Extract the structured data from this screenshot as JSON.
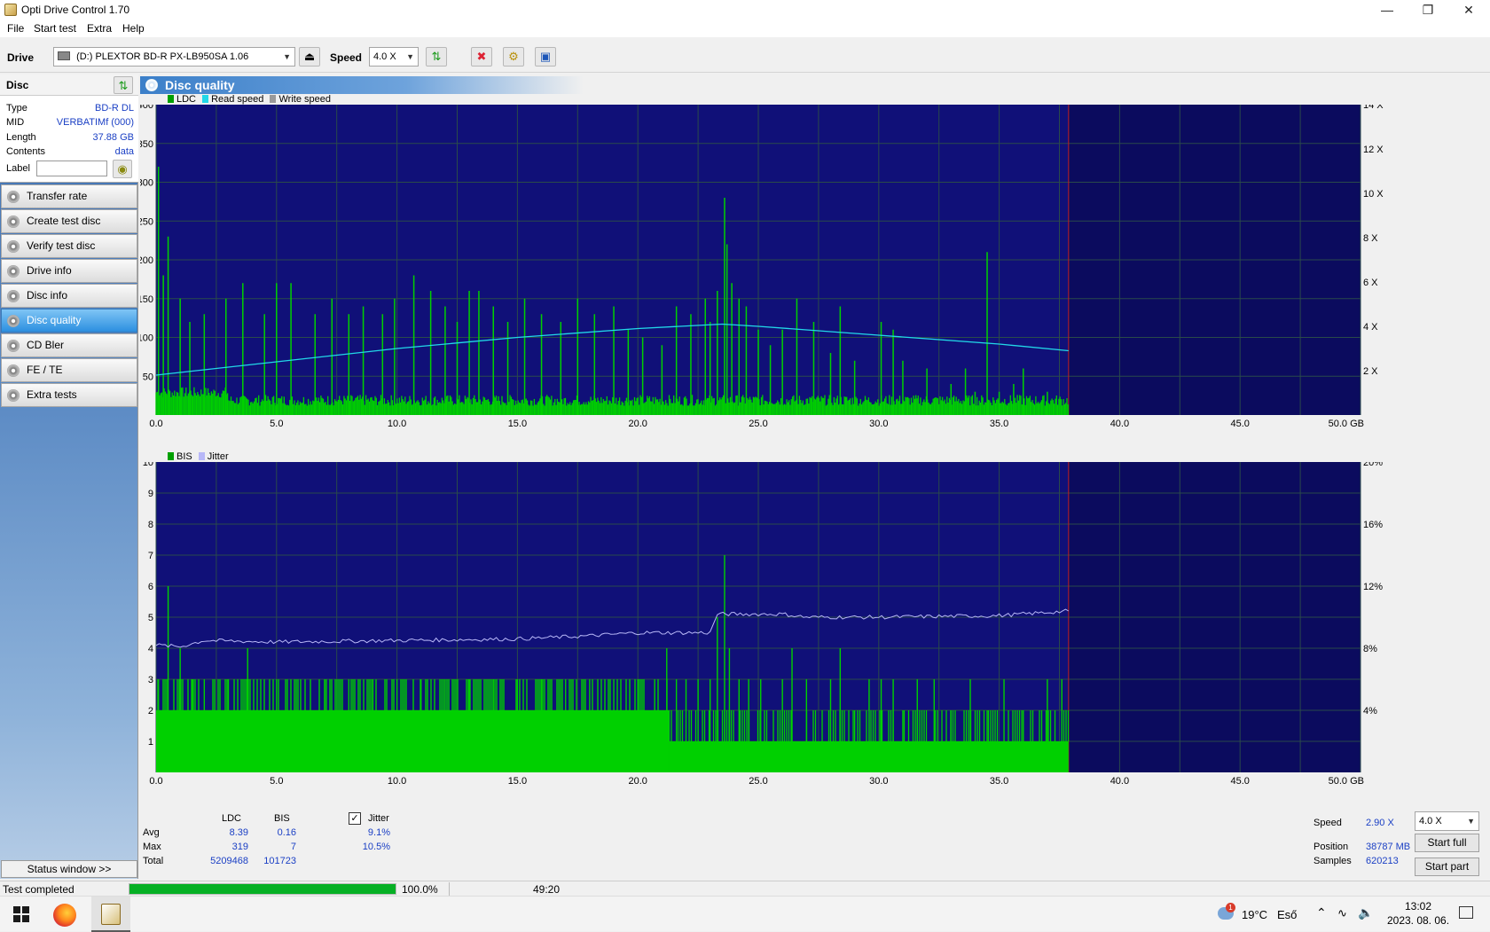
{
  "window": {
    "title": "Opti Drive Control 1.70"
  },
  "menu": {
    "items": [
      "File",
      "Start test",
      "Extra",
      "Help"
    ]
  },
  "toolbar": {
    "drive_label": "Drive",
    "drive_value": "(D:)   PLEXTOR BD-R  PX-LB950SA 1.06",
    "speed_label": "Speed",
    "speed_value": "4.0 X"
  },
  "disc": {
    "header": "Disc",
    "rows": [
      {
        "key": "Type",
        "value": "BD-R DL"
      },
      {
        "key": "MID",
        "value": "VERBATIMf (000)"
      },
      {
        "key": "Length",
        "value": "37.88 GB"
      },
      {
        "key": "Contents",
        "value": "data"
      }
    ],
    "label_key": "Label",
    "label_value": ""
  },
  "nav": {
    "items": [
      {
        "label": "Transfer rate",
        "active": false
      },
      {
        "label": "Create test disc",
        "active": false
      },
      {
        "label": "Verify test disc",
        "active": false
      },
      {
        "label": "Drive info",
        "active": false
      },
      {
        "label": "Disc info",
        "active": false
      },
      {
        "label": "Disc quality",
        "active": true
      },
      {
        "label": "CD Bler",
        "active": false
      },
      {
        "label": "FE / TE",
        "active": false
      },
      {
        "label": "Extra tests",
        "active": false
      }
    ],
    "status_window": "Status window >>"
  },
  "panel": {
    "title": "Disc quality"
  },
  "chart_data": [
    {
      "type": "bar",
      "legend": [
        "LDC",
        "Read speed",
        "Write speed"
      ],
      "colors": {
        "LDC": "#00d000",
        "Read speed": "#22d8e8",
        "Write speed": "#9a9a9a",
        "background": "#0b0b5e"
      },
      "x_label_unit": "GB",
      "xlim": [
        0,
        50
      ],
      "x_ticks": [
        "0.0",
        "5.0",
        "10.0",
        "15.0",
        "20.0",
        "25.0",
        "30.0",
        "35.0",
        "40.0",
        "45.0",
        "50.0 GB"
      ],
      "ylim": [
        0,
        400
      ],
      "y_ticks": [
        "50",
        "100",
        "150",
        "200",
        "250",
        "300",
        "350",
        "400"
      ],
      "y2lim": [
        0,
        14
      ],
      "y2_ticks": [
        "2 X",
        "4 X",
        "6 X",
        "8 X",
        "10 X",
        "12 X",
        "14 X"
      ],
      "test_end_gb": 37.88,
      "ldc_base": 12,
      "ldc_spikes": [
        [
          0.1,
          320
        ],
        [
          0.3,
          180
        ],
        [
          0.5,
          230
        ],
        [
          1.0,
          150
        ],
        [
          1.4,
          120
        ],
        [
          2.0,
          130
        ],
        [
          2.9,
          150
        ],
        [
          3.6,
          170
        ],
        [
          4.5,
          130
        ],
        [
          5.0,
          170
        ],
        [
          5.6,
          170
        ],
        [
          6.6,
          130
        ],
        [
          7.3,
          150
        ],
        [
          8.0,
          130
        ],
        [
          8.6,
          140
        ],
        [
          9.4,
          130
        ],
        [
          9.9,
          150
        ],
        [
          10.7,
          180
        ],
        [
          11.4,
          160
        ],
        [
          12.0,
          140
        ],
        [
          12.5,
          120
        ],
        [
          13.0,
          160
        ],
        [
          13.4,
          160
        ],
        [
          14.0,
          140
        ],
        [
          14.6,
          120
        ],
        [
          15.3,
          150
        ],
        [
          16.0,
          130
        ],
        [
          16.8,
          120
        ],
        [
          17.5,
          150
        ],
        [
          18.2,
          130
        ],
        [
          19.0,
          140
        ],
        [
          19.6,
          110
        ],
        [
          20.2,
          100
        ],
        [
          21.0,
          90
        ],
        [
          21.6,
          140
        ],
        [
          22.2,
          130
        ],
        [
          22.8,
          150
        ],
        [
          23.0,
          120
        ],
        [
          23.3,
          160
        ],
        [
          23.6,
          280
        ],
        [
          23.7,
          220
        ],
        [
          23.9,
          170
        ],
        [
          24.2,
          150
        ],
        [
          24.5,
          140
        ],
        [
          25.0,
          110
        ],
        [
          25.5,
          90
        ],
        [
          26.0,
          110
        ],
        [
          26.6,
          150
        ],
        [
          27.3,
          120
        ],
        [
          28.0,
          80
        ],
        [
          28.4,
          140
        ],
        [
          29.0,
          70
        ],
        [
          30.1,
          120
        ],
        [
          30.6,
          110
        ],
        [
          31.0,
          70
        ],
        [
          32.0,
          60
        ],
        [
          33.0,
          40
        ],
        [
          33.6,
          60
        ],
        [
          34.0,
          30
        ],
        [
          34.5,
          210
        ],
        [
          35.0,
          30
        ],
        [
          35.6,
          40
        ],
        [
          36.0,
          60
        ],
        [
          37.0,
          30
        ]
      ],
      "read_speed_x": [
        [
          0,
          1.8
        ],
        [
          5,
          2.4
        ],
        [
          10,
          3.0
        ],
        [
          15,
          3.5
        ],
        [
          20,
          3.9
        ],
        [
          23.5,
          4.1
        ],
        [
          25,
          4.0
        ],
        [
          30,
          3.6
        ],
        [
          35,
          3.2
        ],
        [
          37.88,
          2.9
        ]
      ]
    },
    {
      "type": "bar",
      "legend": [
        "BIS",
        "Jitter"
      ],
      "colors": {
        "BIS": "#00d000",
        "Jitter": "#b8b8f8",
        "background": "#0b0b5e"
      },
      "xlim": [
        0,
        50
      ],
      "x_ticks": [
        "0.0",
        "5.0",
        "10.0",
        "15.0",
        "20.0",
        "25.0",
        "30.0",
        "35.0",
        "40.0",
        "45.0",
        "50.0 GB"
      ],
      "ylim": [
        0,
        10
      ],
      "y_ticks": [
        "1",
        "2",
        "3",
        "4",
        "5",
        "6",
        "7",
        "8",
        "9",
        "10"
      ],
      "y2lim": [
        0,
        20
      ],
      "y2_ticks": [
        "4%",
        "8%",
        "12%",
        "16%",
        "20%"
      ],
      "test_end_gb": 37.88,
      "bis_base_segments": [
        [
          0,
          21.3,
          2
        ],
        [
          21.3,
          37.88,
          1
        ]
      ],
      "bis_spikes": [
        [
          0.1,
          3
        ],
        [
          0.5,
          6
        ],
        [
          1.0,
          4
        ],
        [
          1.5,
          3
        ],
        [
          2.0,
          3
        ],
        [
          3.0,
          3
        ],
        [
          3.8,
          4
        ],
        [
          5.0,
          3
        ],
        [
          6.0,
          3
        ],
        [
          7.0,
          3
        ],
        [
          8.0,
          3
        ],
        [
          9.0,
          3
        ],
        [
          10.0,
          3
        ],
        [
          11.0,
          3
        ],
        [
          12.0,
          3
        ],
        [
          13.0,
          3
        ],
        [
          14.0,
          3
        ],
        [
          15.0,
          3
        ],
        [
          16.0,
          3
        ],
        [
          17.0,
          3
        ],
        [
          18.0,
          3
        ],
        [
          19.0,
          3
        ],
        [
          20.0,
          3
        ],
        [
          20.7,
          3
        ],
        [
          21.2,
          4
        ],
        [
          21.6,
          3
        ],
        [
          22.0,
          3
        ],
        [
          22.5,
          3
        ],
        [
          23.0,
          3
        ],
        [
          23.3,
          5
        ],
        [
          23.6,
          7
        ],
        [
          23.8,
          4
        ],
        [
          24.2,
          3
        ],
        [
          24.6,
          3
        ],
        [
          25.1,
          3
        ],
        [
          26.0,
          3
        ],
        [
          26.4,
          4
        ],
        [
          27.0,
          3
        ],
        [
          28.0,
          3
        ],
        [
          28.4,
          4
        ],
        [
          29.0,
          2
        ],
        [
          29.6,
          3
        ],
        [
          30.1,
          3
        ],
        [
          30.6,
          3
        ],
        [
          31.0,
          2
        ],
        [
          31.6,
          3
        ],
        [
          32.3,
          3
        ],
        [
          33.0,
          2
        ],
        [
          33.8,
          3
        ],
        [
          34.5,
          2
        ],
        [
          35.2,
          3
        ],
        [
          36.0,
          2
        ],
        [
          37.0,
          3
        ],
        [
          37.6,
          3
        ]
      ],
      "jitter_pct": [
        [
          0,
          8.2
        ],
        [
          1,
          8.1
        ],
        [
          2,
          8.5
        ],
        [
          5,
          8.4
        ],
        [
          10,
          8.5
        ],
        [
          15,
          8.6
        ],
        [
          18,
          8.8
        ],
        [
          20,
          9.0
        ],
        [
          21,
          9.0
        ],
        [
          23,
          9.0
        ],
        [
          23.3,
          10.2
        ],
        [
          24,
          10.2
        ],
        [
          26,
          10.2
        ],
        [
          27,
          10.0
        ],
        [
          30,
          10.0
        ],
        [
          35,
          10.1
        ],
        [
          37.88,
          10.4
        ]
      ]
    }
  ],
  "stats": {
    "col_ldc": "LDC",
    "col_bis": "BIS",
    "jitter_label": "Jitter",
    "jitter_checked": true,
    "rows": [
      {
        "label": "Avg",
        "ldc": "8.39",
        "bis": "0.16",
        "jitter": "9.1%"
      },
      {
        "label": "Max",
        "ldc": "319",
        "bis": "7",
        "jitter": "10.5%"
      },
      {
        "label": "Total",
        "ldc": "5209468",
        "bis": "101723",
        "jitter": ""
      }
    ]
  },
  "right_stats": {
    "speed_label": "Speed",
    "speed_value": "2.90 X",
    "speed_select": "4.0 X",
    "position_label": "Position",
    "position_value": "38787 MB",
    "samples_label": "Samples",
    "samples_value": "620213",
    "start_full": "Start full",
    "start_part": "Start part"
  },
  "status": {
    "text": "Test completed",
    "progress": 1.0,
    "progress_text": "100.0%",
    "elapsed": "49:20"
  },
  "taskbar": {
    "weather_temp": "19°C",
    "weather_text": "Eső",
    "weather_badge": "1",
    "time": "13:02",
    "date": "2023. 08. 06."
  }
}
